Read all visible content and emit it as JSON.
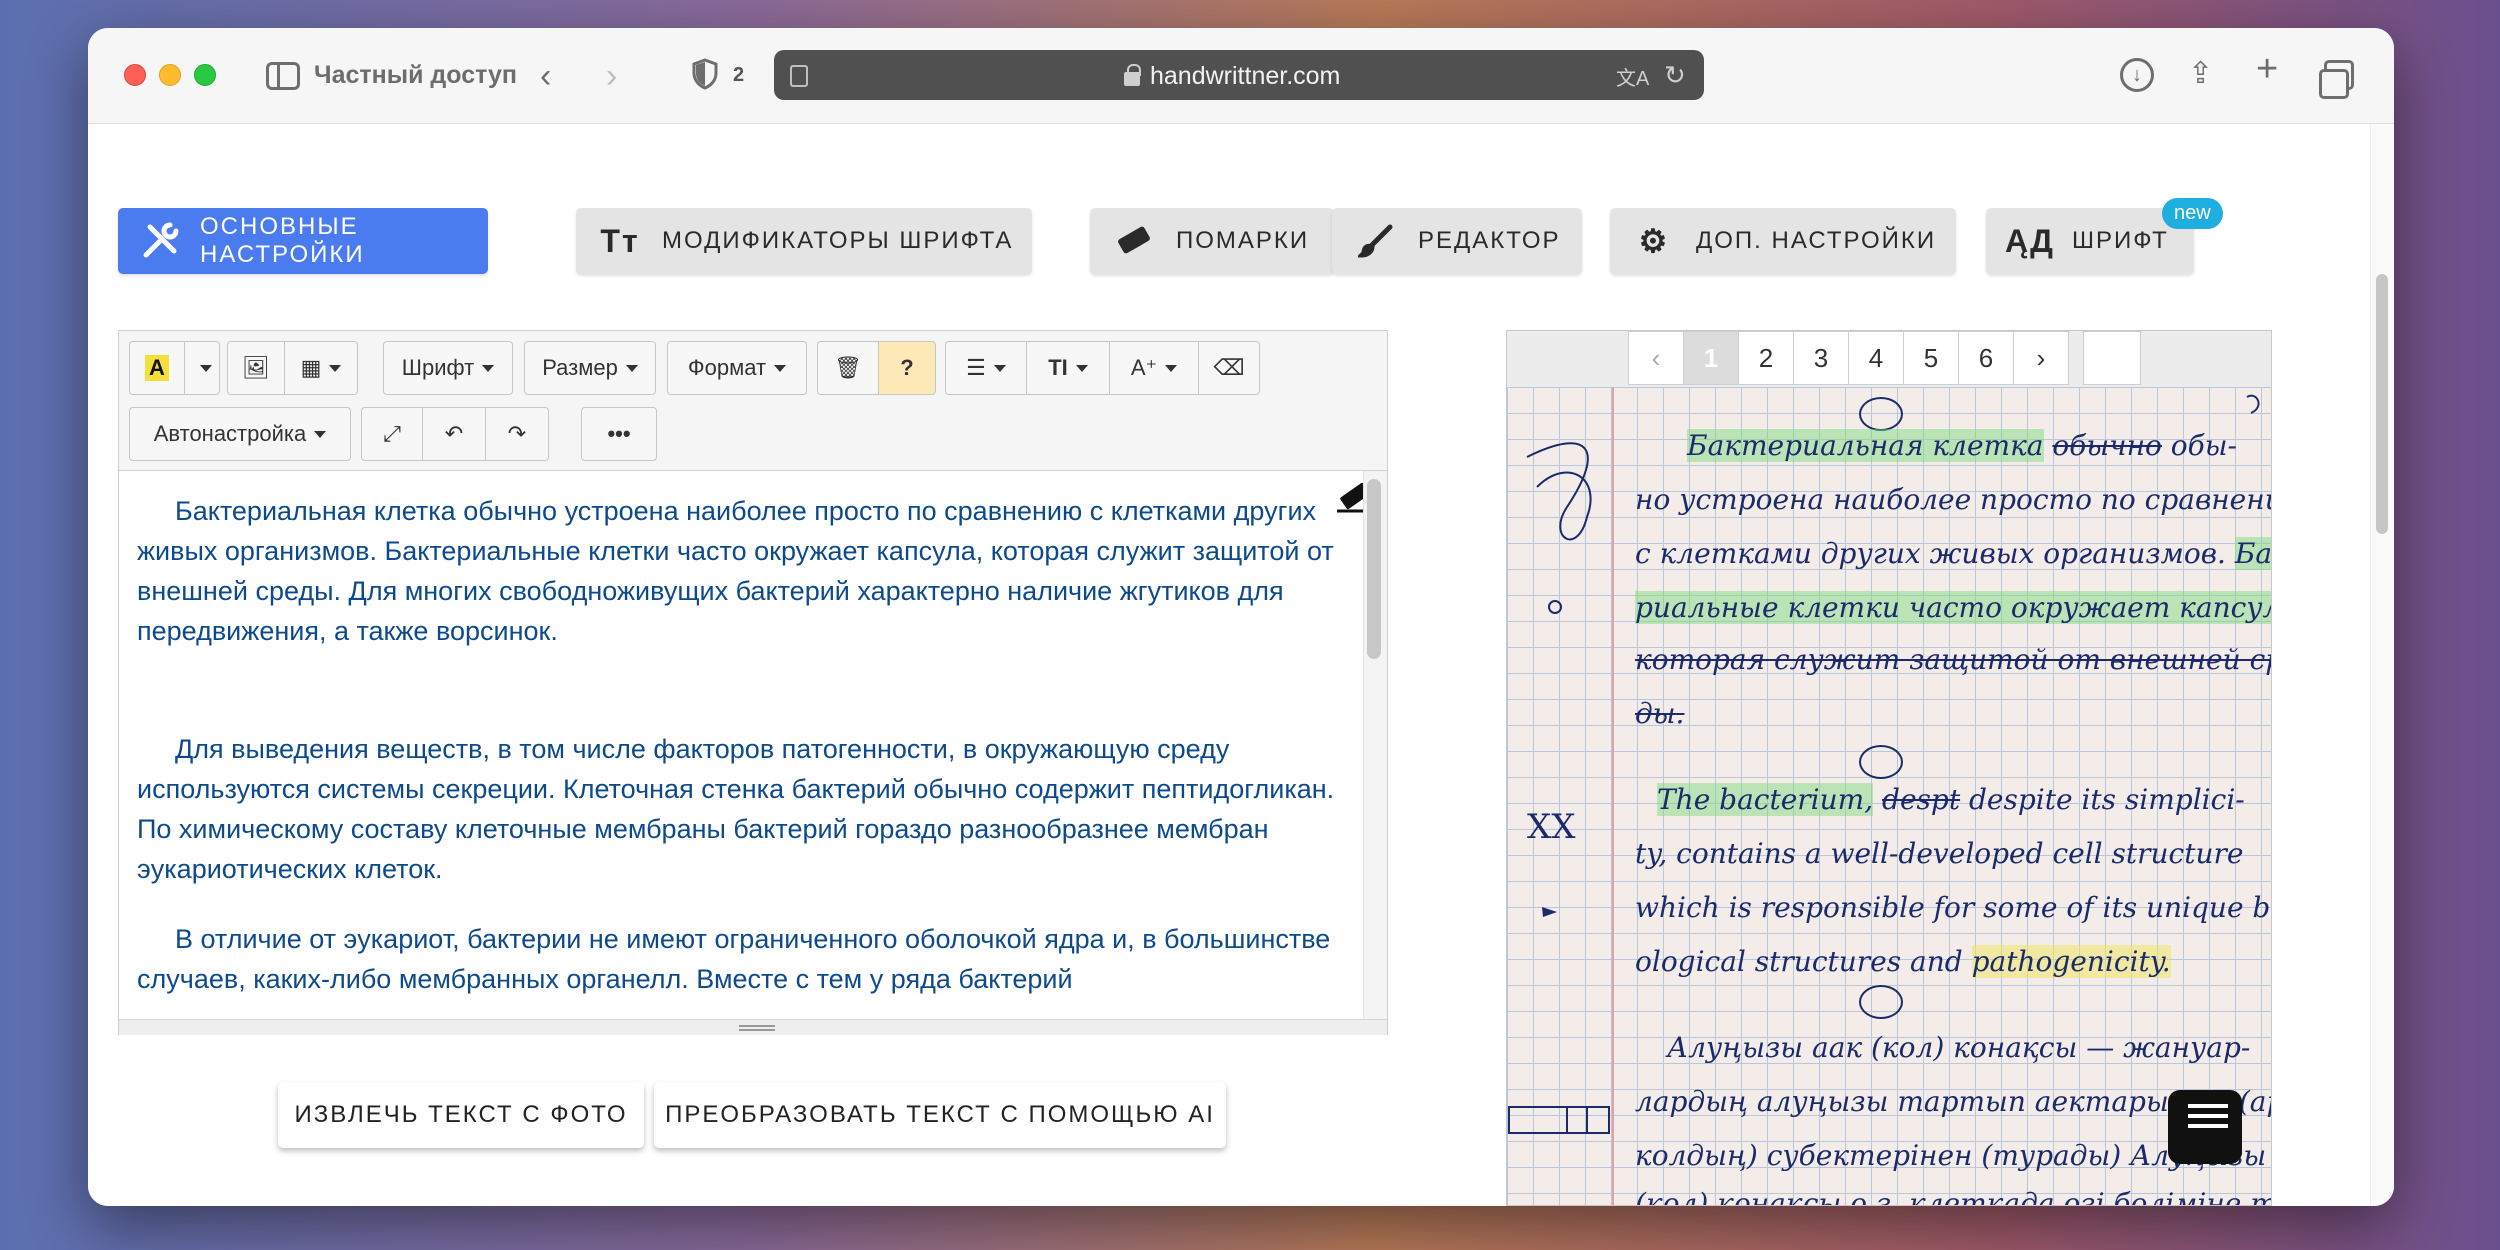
{
  "browser": {
    "private_label": "Частный доступ",
    "blocked_count": "2",
    "url": "handwrittner.com"
  },
  "tabs": [
    {
      "label": "ОСНОВНЫЕ НАСТРОЙКИ",
      "icon": "tools-icon",
      "active": true
    },
    {
      "label": "МОДИФИКАТОРЫ ШРИФТА",
      "icon": "font-size-icon",
      "active": false
    },
    {
      "label": "ПОМАРКИ",
      "icon": "eraser-icon",
      "active": false
    },
    {
      "label": "РЕДАКТОР",
      "icon": "brush-icon",
      "active": false
    },
    {
      "label": "ДОП. НАСТРОЙКИ",
      "icon": "gear-icon",
      "active": false
    },
    {
      "label": "ШРИФТ",
      "icon": "font-icon",
      "active": false
    }
  ],
  "new_badge": "new",
  "editor_toolbar": {
    "font": "Шрифт",
    "size": "Размер",
    "format": "Формат",
    "autosetup": "Автонастройка",
    "help": "?"
  },
  "editor_text": {
    "p1": "Бактериальная клетка обычно устроена наиболее просто по сравнению с клетками других живых организмов. Бактериальные клетки часто окружает капсула, которая служит защитой от внешней среды. Для многих свободноживущих бактерий характерно наличие жгутиков для передвижения, а также ворсинок.",
    "p2": "Для выведения веществ, в том числе факторов патогенности, в окружающую среду используются системы секреции. Клеточная стенка бактерий обычно содержит пептидогликан. По химическому составу клеточные мембраны бактерий гораздо разнообразнее мембран эукариотических клеток.",
    "p3": "В отличие от эукариот, бактерии не имеют ограниченного оболочкой ядра и, в большинстве случаев, каких-либо мембранных органелл. Вместе с тем у ряда бактерий"
  },
  "actions": {
    "extract": "ИЗВЛЕЧЬ ТЕКСТ С ФОТО",
    "convert": "ПРЕОБРАЗОВАТЬ ТЕКСТ С ПОМОЩЬЮ AI"
  },
  "pager": {
    "prev": "‹",
    "pages": [
      "1",
      "2",
      "3",
      "4",
      "5",
      "6"
    ],
    "next": "›",
    "active_page": "1"
  },
  "handwriting": {
    "l1a": "Бактериальная клетка",
    "l1b": "обычно",
    "l1c": "обы-",
    "l2": "но устроена наиболее просто по сравнению",
    "l3a": "с клетками других живых организмов.",
    "l3b": "Бакте-",
    "l4": "риальные клетки часто окружает капсула,",
    "l5": "которая служит защитой от внешней сре-",
    "l6": "ды.",
    "l7a": "The bacterium,",
    "l7b": "despt",
    "l7c": "despite its simplici-",
    "l8": "ty, contains a well-developed cell structure",
    "l9": "which is responsible for some of its unique bi-",
    "l10a": "ological structures and",
    "l10b": "pathogenicity.",
    "l11": "Алуңызы аак (кол) конақсы — жануар-",
    "l12": "лардың алуңызы тартып аектарының (арамда",
    "l13": "колдың) субектерінен (турады) Алуңызы аак",
    "l14": "(кол) конақсы ө.з. клеткада өзі бөліміне т.ш."
  },
  "margin_marks": "XX"
}
